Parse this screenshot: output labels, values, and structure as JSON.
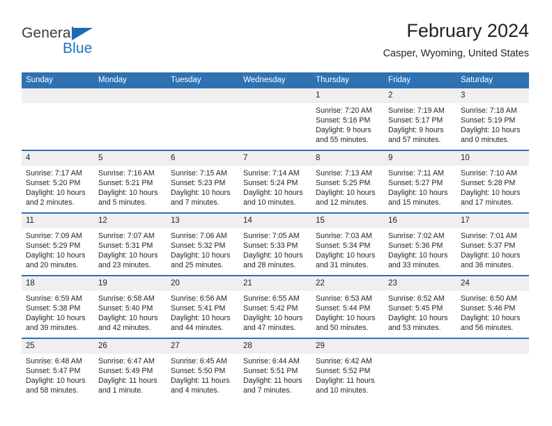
{
  "brand": {
    "name_top": "General",
    "name_bottom": "Blue",
    "triangle_icon": "blue-triangle-logo-icon",
    "color_top": "#3b3b3b",
    "color_bottom": "#1c74c0"
  },
  "header": {
    "title": "February 2024",
    "subtitle": "Casper, Wyoming, United States"
  },
  "theme": {
    "header_blue": "#2f72b4",
    "daynum_band": "#efefef",
    "text": "#231f20"
  },
  "calendar": {
    "weekday_headers": [
      "Sunday",
      "Monday",
      "Tuesday",
      "Wednesday",
      "Thursday",
      "Friday",
      "Saturday"
    ],
    "weeks": [
      [
        {
          "day": "",
          "lines": []
        },
        {
          "day": "",
          "lines": []
        },
        {
          "day": "",
          "lines": []
        },
        {
          "day": "",
          "lines": []
        },
        {
          "day": "1",
          "lines": [
            "Sunrise: 7:20 AM",
            "Sunset: 5:16 PM",
            "Daylight: 9 hours",
            "and 55 minutes."
          ]
        },
        {
          "day": "2",
          "lines": [
            "Sunrise: 7:19 AM",
            "Sunset: 5:17 PM",
            "Daylight: 9 hours",
            "and 57 minutes."
          ]
        },
        {
          "day": "3",
          "lines": [
            "Sunrise: 7:18 AM",
            "Sunset: 5:19 PM",
            "Daylight: 10 hours",
            "and 0 minutes."
          ]
        }
      ],
      [
        {
          "day": "4",
          "lines": [
            "Sunrise: 7:17 AM",
            "Sunset: 5:20 PM",
            "Daylight: 10 hours",
            "and 2 minutes."
          ]
        },
        {
          "day": "5",
          "lines": [
            "Sunrise: 7:16 AM",
            "Sunset: 5:21 PM",
            "Daylight: 10 hours",
            "and 5 minutes."
          ]
        },
        {
          "day": "6",
          "lines": [
            "Sunrise: 7:15 AM",
            "Sunset: 5:23 PM",
            "Daylight: 10 hours",
            "and 7 minutes."
          ]
        },
        {
          "day": "7",
          "lines": [
            "Sunrise: 7:14 AM",
            "Sunset: 5:24 PM",
            "Daylight: 10 hours",
            "and 10 minutes."
          ]
        },
        {
          "day": "8",
          "lines": [
            "Sunrise: 7:13 AM",
            "Sunset: 5:25 PM",
            "Daylight: 10 hours",
            "and 12 minutes."
          ]
        },
        {
          "day": "9",
          "lines": [
            "Sunrise: 7:11 AM",
            "Sunset: 5:27 PM",
            "Daylight: 10 hours",
            "and 15 minutes."
          ]
        },
        {
          "day": "10",
          "lines": [
            "Sunrise: 7:10 AM",
            "Sunset: 5:28 PM",
            "Daylight: 10 hours",
            "and 17 minutes."
          ]
        }
      ],
      [
        {
          "day": "11",
          "lines": [
            "Sunrise: 7:09 AM",
            "Sunset: 5:29 PM",
            "Daylight: 10 hours",
            "and 20 minutes."
          ]
        },
        {
          "day": "12",
          "lines": [
            "Sunrise: 7:07 AM",
            "Sunset: 5:31 PM",
            "Daylight: 10 hours",
            "and 23 minutes."
          ]
        },
        {
          "day": "13",
          "lines": [
            "Sunrise: 7:06 AM",
            "Sunset: 5:32 PM",
            "Daylight: 10 hours",
            "and 25 minutes."
          ]
        },
        {
          "day": "14",
          "lines": [
            "Sunrise: 7:05 AM",
            "Sunset: 5:33 PM",
            "Daylight: 10 hours",
            "and 28 minutes."
          ]
        },
        {
          "day": "15",
          "lines": [
            "Sunrise: 7:03 AM",
            "Sunset: 5:34 PM",
            "Daylight: 10 hours",
            "and 31 minutes."
          ]
        },
        {
          "day": "16",
          "lines": [
            "Sunrise: 7:02 AM",
            "Sunset: 5:36 PM",
            "Daylight: 10 hours",
            "and 33 minutes."
          ]
        },
        {
          "day": "17",
          "lines": [
            "Sunrise: 7:01 AM",
            "Sunset: 5:37 PM",
            "Daylight: 10 hours",
            "and 36 minutes."
          ]
        }
      ],
      [
        {
          "day": "18",
          "lines": [
            "Sunrise: 6:59 AM",
            "Sunset: 5:38 PM",
            "Daylight: 10 hours",
            "and 39 minutes."
          ]
        },
        {
          "day": "19",
          "lines": [
            "Sunrise: 6:58 AM",
            "Sunset: 5:40 PM",
            "Daylight: 10 hours",
            "and 42 minutes."
          ]
        },
        {
          "day": "20",
          "lines": [
            "Sunrise: 6:56 AM",
            "Sunset: 5:41 PM",
            "Daylight: 10 hours",
            "and 44 minutes."
          ]
        },
        {
          "day": "21",
          "lines": [
            "Sunrise: 6:55 AM",
            "Sunset: 5:42 PM",
            "Daylight: 10 hours",
            "and 47 minutes."
          ]
        },
        {
          "day": "22",
          "lines": [
            "Sunrise: 6:53 AM",
            "Sunset: 5:44 PM",
            "Daylight: 10 hours",
            "and 50 minutes."
          ]
        },
        {
          "day": "23",
          "lines": [
            "Sunrise: 6:52 AM",
            "Sunset: 5:45 PM",
            "Daylight: 10 hours",
            "and 53 minutes."
          ]
        },
        {
          "day": "24",
          "lines": [
            "Sunrise: 6:50 AM",
            "Sunset: 5:46 PM",
            "Daylight: 10 hours",
            "and 56 minutes."
          ]
        }
      ],
      [
        {
          "day": "25",
          "lines": [
            "Sunrise: 6:48 AM",
            "Sunset: 5:47 PM",
            "Daylight: 10 hours",
            "and 58 minutes."
          ]
        },
        {
          "day": "26",
          "lines": [
            "Sunrise: 6:47 AM",
            "Sunset: 5:49 PM",
            "Daylight: 11 hours",
            "and 1 minute."
          ]
        },
        {
          "day": "27",
          "lines": [
            "Sunrise: 6:45 AM",
            "Sunset: 5:50 PM",
            "Daylight: 11 hours",
            "and 4 minutes."
          ]
        },
        {
          "day": "28",
          "lines": [
            "Sunrise: 6:44 AM",
            "Sunset: 5:51 PM",
            "Daylight: 11 hours",
            "and 7 minutes."
          ]
        },
        {
          "day": "29",
          "lines": [
            "Sunrise: 6:42 AM",
            "Sunset: 5:52 PM",
            "Daylight: 11 hours",
            "and 10 minutes."
          ]
        },
        {
          "day": "",
          "lines": []
        },
        {
          "day": "",
          "lines": []
        }
      ]
    ]
  }
}
